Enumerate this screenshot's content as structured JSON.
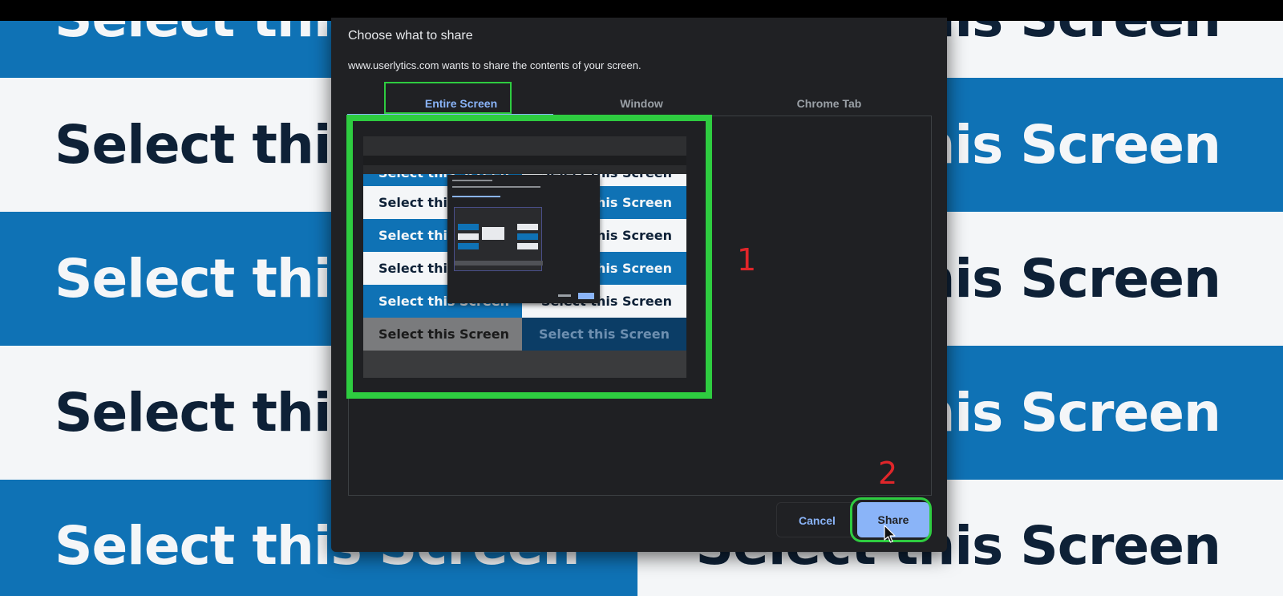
{
  "background": {
    "tile_text_left": "Select this Screen",
    "tile_text_right": "Select this Screen",
    "colors": {
      "blue": "#0f72b5",
      "white": "#f4f6f8",
      "navy_text": "#0e2137"
    }
  },
  "dialog": {
    "title": "Choose what to share",
    "subtitle": "www.userlytics.com wants to share the contents of your screen.",
    "tabs": [
      {
        "label": "Entire Screen",
        "active": true
      },
      {
        "label": "Window",
        "active": false
      },
      {
        "label": "Chrome Tab",
        "active": false
      }
    ],
    "thumbnail": {
      "tile_text": "Select this Screen"
    },
    "buttons": {
      "cancel_label": "Cancel",
      "share_label": "Share"
    },
    "colors": {
      "accent": "#8ab4f8",
      "background": "#202124",
      "highlight": "#2ecc40"
    }
  },
  "annotations": {
    "step1": "1",
    "step2": "2",
    "color": "#e0262a"
  },
  "icons": {
    "cursor": "mouse-pointer-icon"
  }
}
